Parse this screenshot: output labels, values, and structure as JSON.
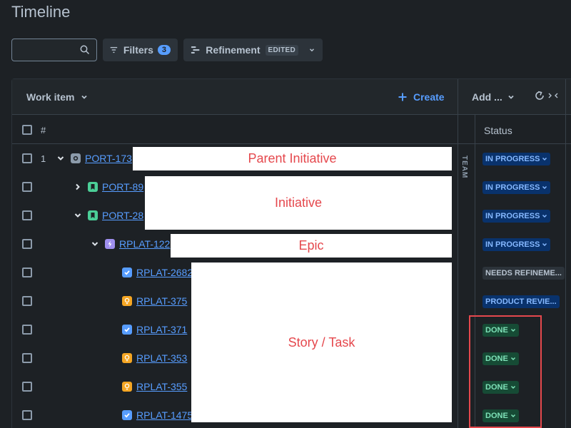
{
  "page": {
    "title": "Timeline"
  },
  "toolbar": {
    "search_value": "",
    "filters_label": "Filters",
    "filters_count": "3",
    "view_label": "Refinement",
    "view_badge": "EDITED"
  },
  "table": {
    "work_item_header": "Work item",
    "create_label": "Create",
    "add_label": "Add ...",
    "hash_header": "#",
    "status_header": "Status",
    "team_label": "TEAM",
    "rows": [
      {
        "num": "1",
        "key": "PORT-173",
        "type": "parent-initiative",
        "status": "IN PROGRESS",
        "status_kind": "progress"
      },
      {
        "num": "",
        "key": "PORT-89",
        "type": "initiative",
        "status": "IN PROGRESS",
        "status_kind": "progress"
      },
      {
        "num": "",
        "key": "PORT-28",
        "type": "initiative",
        "status": "IN PROGRESS",
        "status_kind": "progress"
      },
      {
        "num": "",
        "key": "RPLAT-122",
        "type": "epic",
        "status": "IN PROGRESS",
        "status_kind": "progress"
      },
      {
        "num": "",
        "key": "RPLAT-2682",
        "type": "task",
        "status": "NEEDS REFINEME...",
        "status_kind": "refine"
      },
      {
        "num": "",
        "key": "RPLAT-375",
        "type": "idea",
        "status": "PRODUCT REVIE...",
        "status_kind": "product"
      },
      {
        "num": "",
        "key": "RPLAT-371",
        "type": "task",
        "status": "DONE",
        "status_kind": "done"
      },
      {
        "num": "",
        "key": "RPLAT-353",
        "type": "idea",
        "status": "DONE",
        "status_kind": "done"
      },
      {
        "num": "",
        "key": "RPLAT-355",
        "type": "idea",
        "status": "DONE",
        "status_kind": "done"
      },
      {
        "num": "",
        "key": "RPLAT-1475",
        "type": "task",
        "status": "DONE",
        "status_kind": "done"
      }
    ]
  },
  "annotations": {
    "parent_initiative": "Parent Initiative",
    "initiative": "Initiative",
    "epic": "Epic",
    "story_task": "Story / Task"
  },
  "colors": {
    "background": "#1d2125",
    "link": "#579dff",
    "in_progress": "#85b8ff",
    "done": "#7ee2b8",
    "annotation_red": "#e5484d",
    "initiative_green": "#4bce97",
    "epic_purple": "#9f8fef",
    "task_blue": "#579dff",
    "idea_orange": "#f5a623"
  }
}
